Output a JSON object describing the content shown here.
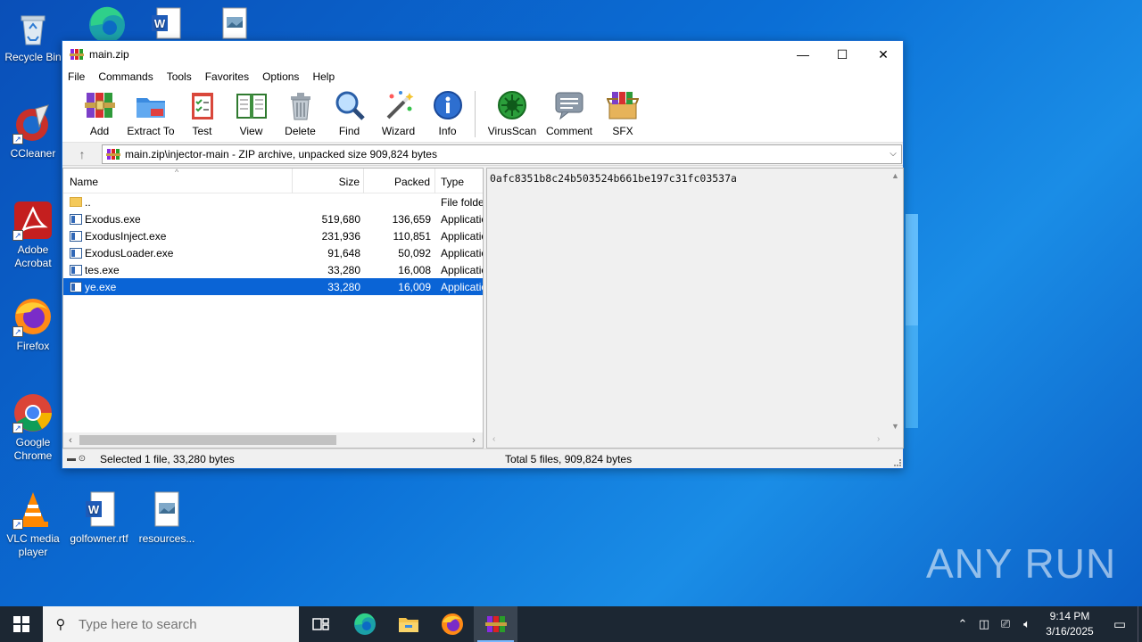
{
  "desktop": {
    "icons": [
      {
        "label": "Recycle Bin"
      },
      {
        "label": "CCleaner"
      },
      {
        "label": "Adobe Acrobat"
      },
      {
        "label": "Firefox"
      },
      {
        "label": "Google Chrome"
      },
      {
        "label": "VLC media player"
      },
      {
        "label": "golfowner.rtf"
      },
      {
        "label": "resources..."
      }
    ],
    "watermark": "ANY RUN"
  },
  "window": {
    "title": "main.zip",
    "controls": {
      "minimize": "—",
      "maximize": "☐",
      "close": "✕"
    },
    "menu": [
      "File",
      "Commands",
      "Tools",
      "Favorites",
      "Options",
      "Help"
    ],
    "toolbar": [
      {
        "label": "Add",
        "icon": "add-archive-icon"
      },
      {
        "label": "Extract To",
        "icon": "extract-folder-icon"
      },
      {
        "label": "Test",
        "icon": "test-clipboard-icon"
      },
      {
        "label": "View",
        "icon": "view-book-icon"
      },
      {
        "label": "Delete",
        "icon": "trash-icon"
      },
      {
        "label": "Find",
        "icon": "magnifier-icon"
      },
      {
        "label": "Wizard",
        "icon": "wand-icon"
      },
      {
        "label": "Info",
        "icon": "info-icon"
      },
      {
        "label": "VirusScan",
        "icon": "virus-scan-icon"
      },
      {
        "label": "Comment",
        "icon": "comment-icon"
      },
      {
        "label": "SFX",
        "icon": "sfx-box-icon"
      }
    ],
    "address": "main.zip\\injector-main - ZIP archive, unpacked size 909,824 bytes",
    "columns": {
      "name": "Name",
      "size": "Size",
      "packed": "Packed",
      "type": "Type"
    },
    "files": [
      {
        "name": "..",
        "size": "",
        "packed": "",
        "type": "File folder",
        "kind": "folder"
      },
      {
        "name": "Exodus.exe",
        "size": "519,680",
        "packed": "136,659",
        "type": "Application",
        "kind": "exe"
      },
      {
        "name": "ExodusInject.exe",
        "size": "231,936",
        "packed": "110,851",
        "type": "Application",
        "kind": "exe"
      },
      {
        "name": "ExodusLoader.exe",
        "size": "91,648",
        "packed": "50,092",
        "type": "Application",
        "kind": "exe"
      },
      {
        "name": "tes.exe",
        "size": "33,280",
        "packed": "16,008",
        "type": "Application",
        "kind": "exe"
      },
      {
        "name": "ye.exe",
        "size": "33,280",
        "packed": "16,009",
        "type": "Application",
        "kind": "exe",
        "selected": true
      }
    ],
    "comment_text": "0afc8351b8c24b503524b661be197c31fc03537a",
    "status_left": "Selected 1 file, 33,280 bytes",
    "status_right": "Total 5 files, 909,824 bytes"
  },
  "taskbar": {
    "search_placeholder": "Type here to search",
    "time": "9:14 PM",
    "date": "3/16/2025"
  }
}
